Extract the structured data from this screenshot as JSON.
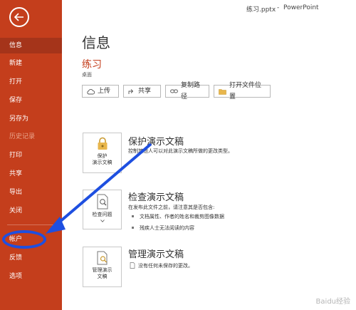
{
  "titlebar": {
    "filename": "练习.pptx",
    "separator": "-",
    "app": "PowerPoint"
  },
  "sidebar": {
    "items": [
      {
        "label": "信息",
        "state": "active"
      },
      {
        "label": "新建"
      },
      {
        "label": "打开"
      },
      {
        "label": "保存"
      },
      {
        "label": "另存为"
      },
      {
        "label": "历史记录",
        "state": "disabled"
      },
      {
        "label": "打印"
      },
      {
        "label": "共享"
      },
      {
        "label": "导出"
      },
      {
        "label": "关闭"
      },
      {
        "label": "帐户"
      },
      {
        "label": "反馈"
      },
      {
        "label": "选项"
      }
    ]
  },
  "main": {
    "heading": "信息",
    "document": {
      "title": "练习",
      "location": "桌面"
    },
    "actions": [
      {
        "label": "上传",
        "icon": "cloud-upload-icon"
      },
      {
        "label": "共享",
        "icon": "share-icon"
      },
      {
        "label": "复制路径",
        "icon": "link-icon"
      },
      {
        "label": "打开文件位置",
        "icon": "folder-icon"
      }
    ],
    "protect": {
      "tile": [
        "保护",
        "演示文稿"
      ],
      "title": "保护演示文稿",
      "desc": "控制其他人可以对此演示文稿所做的更改类型。"
    },
    "inspect": {
      "tile": [
        "检查问题"
      ],
      "title": "检查演示文稿",
      "desc": "在发布此文件之前，请注意其是否包含:",
      "bullets": [
        "文档属性、作者的姓名和裁剪图像数据",
        "残疾人士无法阅读的内容"
      ]
    },
    "manage": {
      "tile": [
        "管理演示",
        "文稿"
      ],
      "title": "管理演示文稿",
      "desc": "没有任何未保存的更改。"
    }
  },
  "watermark": "Baidu经验",
  "colors": {
    "sidebar": "#c43e1c",
    "active": "#a5341a",
    "annotation": "#1e4fe0"
  }
}
